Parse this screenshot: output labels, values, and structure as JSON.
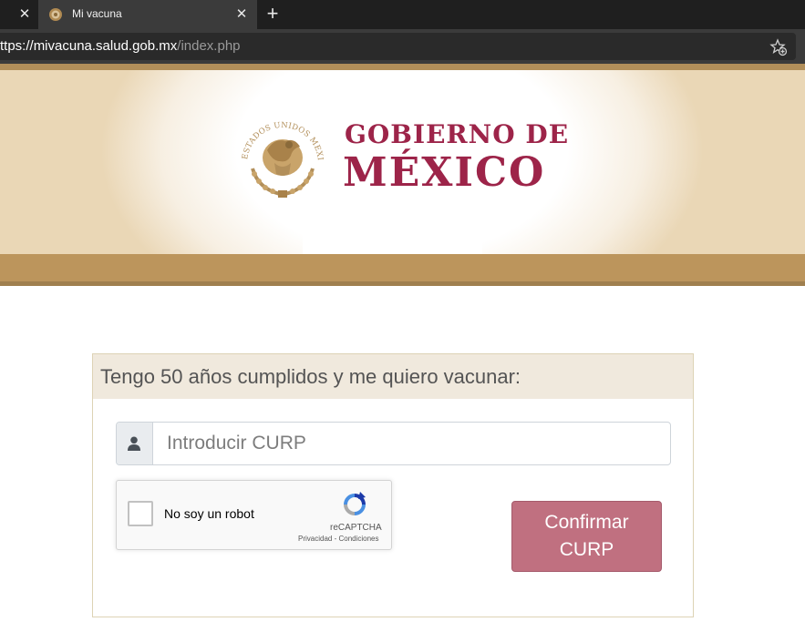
{
  "browser": {
    "tab_title": "Mi vacuna",
    "url_prefix": "ttps://",
    "url_domain": "mivacuna.salud.gob.mx",
    "url_path": "/index.php",
    "icons": [
      "close-icon",
      "favicon-seal-icon",
      "close-icon",
      "plus-icon",
      "add-favorite-icon"
    ]
  },
  "banner": {
    "line1": "GOBIERNO DE",
    "line2": "MÉXICO",
    "seal_text": "ESTADOS UNIDOS MEXICANOS",
    "colors": {
      "brand": "#9d2449",
      "gold": "#bc955c"
    }
  },
  "form": {
    "title": "Tengo 50 años cumplidos y me quiero vacunar:",
    "curp_placeholder": "Introducir CURP",
    "curp_value": "",
    "recaptcha": {
      "label": "No soy un robot",
      "brand": "reCAPTCHA",
      "terms": "Privacidad - Condiciones"
    },
    "confirm_label": "Confirmar CURP",
    "colors": {
      "button": "#c07080",
      "header_bg": "#f0e9dd"
    }
  }
}
